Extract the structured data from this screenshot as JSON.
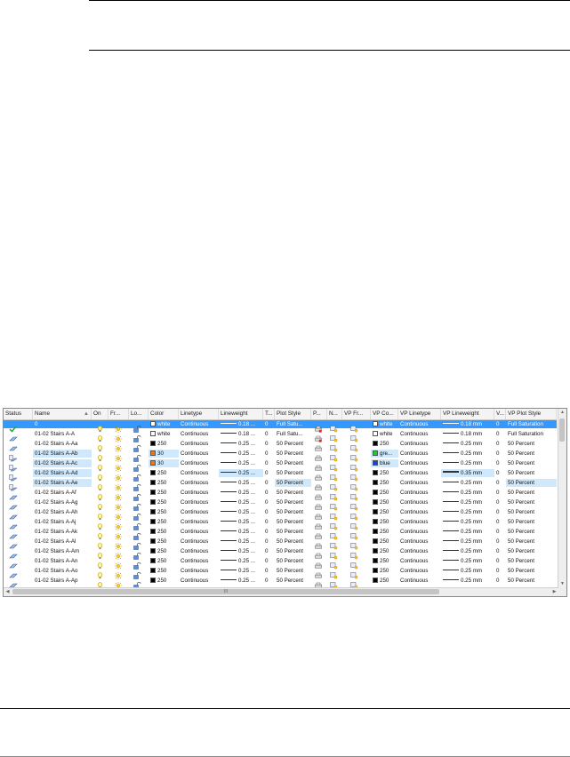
{
  "headers": {
    "status": "Status",
    "name": "Name",
    "on": "On",
    "freeze": "Fr...",
    "lock": "Lo...",
    "color": "Color",
    "linetype": "Linetype",
    "lineweight": "Lineweight",
    "transparency": "T...",
    "plot_style": "Plot Style",
    "plot": "P...",
    "new_vp_freeze": "N...",
    "vp_freeze": "VP Fr...",
    "vp_color": "VP Co...",
    "vp_linetype": "VP Linetype",
    "vp_lineweight": "VP Lineweight",
    "vp_transparency": "V...",
    "vp_plot_style": "VP Plot Style"
  },
  "colors": {
    "selection": "#3399ff",
    "highlight": "#cfe8fb",
    "orange": "#e87722",
    "green": "#22cc22",
    "blue": "#1f3fd6"
  },
  "scrollbar_grip": "III",
  "rows": [
    {
      "status": "current-layer-icon",
      "name": "0",
      "color_name": "white",
      "color_hex": "#ffffff",
      "linetype": "Continuous",
      "lineweight": "0.18 ...",
      "transparency": "0",
      "plot_style": "Full Satu...",
      "vp_color_name": "white",
      "vp_color_hex": "#ffffff",
      "vp_linetype": "Continuous",
      "vp_lineweight": "0.18 mm",
      "vp_transparency": "0",
      "vp_plot_style": "Full Saturation",
      "selected": true,
      "no_plot": true
    },
    {
      "status": "layer-icon",
      "name": "01-02 Stairs A-A",
      "color_name": "white",
      "color_hex": "#ffffff",
      "linetype": "Continuous",
      "lineweight": "0.18 ...",
      "transparency": "0",
      "plot_style": "Full Satu...",
      "vp_color_name": "white",
      "vp_color_hex": "#ffffff",
      "vp_linetype": "Continuous",
      "vp_lineweight": "0.18 mm",
      "vp_transparency": "0",
      "vp_plot_style": "Full Saturation",
      "no_plot": true
    },
    {
      "status": "layer-icon",
      "name": "01-02 Stairs A-Aa",
      "color_name": "250",
      "color_hex": "#000000",
      "linetype": "Continuous",
      "lineweight": "0.25 ...",
      "transparency": "0",
      "plot_style": "50 Percent",
      "vp_color_name": "250",
      "vp_color_hex": "#000000",
      "vp_linetype": "Continuous",
      "vp_lineweight": "0.25 mm",
      "vp_transparency": "0",
      "vp_plot_style": "50 Percent"
    },
    {
      "status": "override-icon",
      "name": "01-02 Stairs A-Ab",
      "color_name": "30",
      "color_hex": "#e87722",
      "linetype": "Continuous",
      "lineweight": "0.25 ...",
      "transparency": "0",
      "plot_style": "50 Percent",
      "vp_color_name": "gre...",
      "vp_color_hex": "#22cc22",
      "vp_linetype": "Continuous",
      "vp_lineweight": "0.25 mm",
      "vp_transparency": "0",
      "vp_plot_style": "50 Percent",
      "hl_name": true,
      "hl_color": true,
      "hl_vpcolor": true
    },
    {
      "status": "override-icon",
      "name": "01-02 Stairs A-Ac",
      "color_name": "30",
      "color_hex": "#e87722",
      "linetype": "Continuous",
      "lineweight": "0.25 ...",
      "transparency": "0",
      "plot_style": "50 Percent",
      "vp_color_name": "blue",
      "vp_color_hex": "#1f3fd6",
      "vp_linetype": "Continuous",
      "vp_lineweight": "0.25 mm",
      "vp_transparency": "0",
      "vp_plot_style": "50 Percent",
      "hl_name": true,
      "hl_color": true,
      "hl_vpcolor": true
    },
    {
      "status": "override-icon",
      "name": "01-02 Stairs A-Ad",
      "color_name": "250",
      "color_hex": "#000000",
      "linetype": "Continuous",
      "lineweight": "0.25 ...",
      "transparency": "0",
      "plot_style": "50 Percent",
      "vp_color_name": "250",
      "vp_color_hex": "#000000",
      "vp_linetype": "Continuous",
      "vp_lineweight": "0.35 mm",
      "vp_transparency": "0",
      "vp_plot_style": "50 Percent",
      "hl_name": true,
      "hl_lw": true,
      "hl_vplw": true,
      "thick_vplw": true
    },
    {
      "status": "override-icon",
      "name": "01-02 Stairs A-Ae",
      "color_name": "250",
      "color_hex": "#000000",
      "linetype": "Continuous",
      "lineweight": "0.25 ...",
      "transparency": "0",
      "plot_style": "50 Percent",
      "vp_color_name": "250",
      "vp_color_hex": "#000000",
      "vp_linetype": "Continuous",
      "vp_lineweight": "0.25 mm",
      "vp_transparency": "0",
      "vp_plot_style": "50 Percent",
      "hl_name": true,
      "hl_ps": true,
      "hl_vpps": true
    },
    {
      "status": "layer-icon",
      "name": "01-02 Stairs A-Af",
      "color_name": "250",
      "color_hex": "#000000",
      "linetype": "Continuous",
      "lineweight": "0.25 ...",
      "transparency": "0",
      "plot_style": "50 Percent",
      "vp_color_name": "250",
      "vp_color_hex": "#000000",
      "vp_linetype": "Continuous",
      "vp_lineweight": "0.25 mm",
      "vp_transparency": "0",
      "vp_plot_style": "50 Percent"
    },
    {
      "status": "layer-icon",
      "name": "01-02 Stairs A-Ag",
      "color_name": "250",
      "color_hex": "#000000",
      "linetype": "Continuous",
      "lineweight": "0.25 ...",
      "transparency": "0",
      "plot_style": "50 Percent",
      "vp_color_name": "250",
      "vp_color_hex": "#000000",
      "vp_linetype": "Continuous",
      "vp_lineweight": "0.25 mm",
      "vp_transparency": "0",
      "vp_plot_style": "50 Percent"
    },
    {
      "status": "layer-icon",
      "name": "01-02 Stairs A-Ah",
      "color_name": "250",
      "color_hex": "#000000",
      "linetype": "Continuous",
      "lineweight": "0.25 ...",
      "transparency": "0",
      "plot_style": "50 Percent",
      "vp_color_name": "250",
      "vp_color_hex": "#000000",
      "vp_linetype": "Continuous",
      "vp_lineweight": "0.25 mm",
      "vp_transparency": "0",
      "vp_plot_style": "50 Percent"
    },
    {
      "status": "layer-icon",
      "name": "01-02 Stairs A-Aj",
      "color_name": "250",
      "color_hex": "#000000",
      "linetype": "Continuous",
      "lineweight": "0.25 ...",
      "transparency": "0",
      "plot_style": "50 Percent",
      "vp_color_name": "250",
      "vp_color_hex": "#000000",
      "vp_linetype": "Continuous",
      "vp_lineweight": "0.25 mm",
      "vp_transparency": "0",
      "vp_plot_style": "50 Percent"
    },
    {
      "status": "layer-icon",
      "name": "01-02 Stairs A-Ak",
      "color_name": "250",
      "color_hex": "#000000",
      "linetype": "Continuous",
      "lineweight": "0.25 ...",
      "transparency": "0",
      "plot_style": "50 Percent",
      "vp_color_name": "250",
      "vp_color_hex": "#000000",
      "vp_linetype": "Continuous",
      "vp_lineweight": "0.25 mm",
      "vp_transparency": "0",
      "vp_plot_style": "50 Percent"
    },
    {
      "status": "layer-icon",
      "name": "01-02 Stairs A-Al",
      "color_name": "250",
      "color_hex": "#000000",
      "linetype": "Continuous",
      "lineweight": "0.25 ...",
      "transparency": "0",
      "plot_style": "50 Percent",
      "vp_color_name": "250",
      "vp_color_hex": "#000000",
      "vp_linetype": "Continuous",
      "vp_lineweight": "0.25 mm",
      "vp_transparency": "0",
      "vp_plot_style": "50 Percent"
    },
    {
      "status": "layer-icon",
      "name": "01-02 Stairs A-Am",
      "color_name": "250",
      "color_hex": "#000000",
      "linetype": "Continuous",
      "lineweight": "0.25 ...",
      "transparency": "0",
      "plot_style": "50 Percent",
      "vp_color_name": "250",
      "vp_color_hex": "#000000",
      "vp_linetype": "Continuous",
      "vp_lineweight": "0.25 mm",
      "vp_transparency": "0",
      "vp_plot_style": "50 Percent"
    },
    {
      "status": "layer-icon",
      "name": "01-02 Stairs A-An",
      "color_name": "250",
      "color_hex": "#000000",
      "linetype": "Continuous",
      "lineweight": "0.25 ...",
      "transparency": "0",
      "plot_style": "50 Percent",
      "vp_color_name": "250",
      "vp_color_hex": "#000000",
      "vp_linetype": "Continuous",
      "vp_lineweight": "0.25 mm",
      "vp_transparency": "0",
      "vp_plot_style": "50 Percent"
    },
    {
      "status": "layer-icon",
      "name": "01-02 Stairs A-Ao",
      "color_name": "250",
      "color_hex": "#000000",
      "linetype": "Continuous",
      "lineweight": "0.25 ...",
      "transparency": "0",
      "plot_style": "50 Percent",
      "vp_color_name": "250",
      "vp_color_hex": "#000000",
      "vp_linetype": "Continuous",
      "vp_lineweight": "0.25 mm",
      "vp_transparency": "0",
      "vp_plot_style": "50 Percent"
    },
    {
      "status": "layer-icon",
      "name": "01-02 Stairs A-Ap",
      "color_name": "250",
      "color_hex": "#000000",
      "linetype": "Continuous",
      "lineweight": "0.25 ...",
      "transparency": "0",
      "plot_style": "50 Percent",
      "vp_color_name": "250",
      "vp_color_hex": "#000000",
      "vp_linetype": "Continuous",
      "vp_lineweight": "0.25 mm",
      "vp_transparency": "0",
      "vp_plot_style": "50 Percent"
    }
  ]
}
